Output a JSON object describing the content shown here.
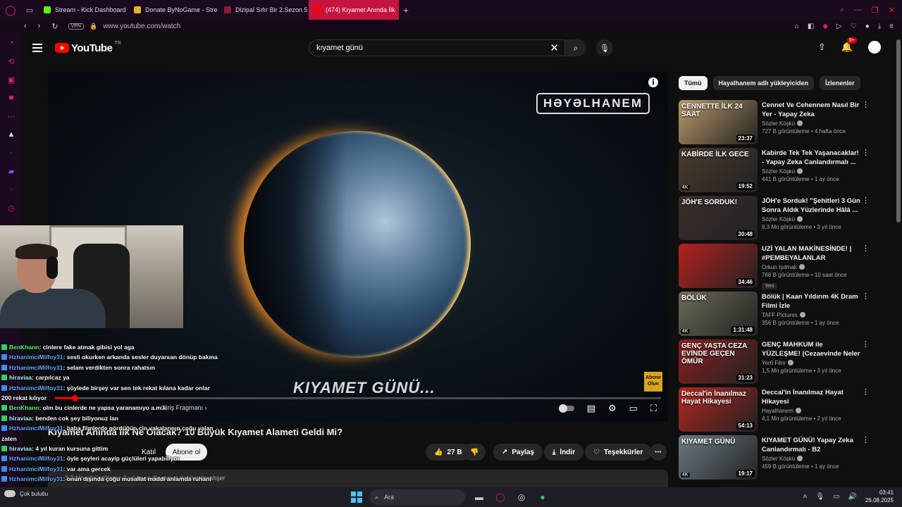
{
  "browser": {
    "tabs": [
      {
        "label": "Stream - Kick Dashboard",
        "color": "#53fc18",
        "active": false
      },
      {
        "label": "Donate ByNoGame - Stre",
        "color": "#e6b422",
        "active": false
      },
      {
        "label": "Dizipal Sıfır Bir 2.Sezon 5",
        "color": "#8a1c3c",
        "active": false
      },
      {
        "label": "(474) Kıyamet Anında İlk",
        "color": "#ff0000",
        "active": true
      }
    ],
    "url": "www.youtube.com/watch",
    "vpn": "VPN"
  },
  "youtube": {
    "logo_word": "YouTube",
    "logo_region": "TR",
    "search_value": "kıyamet günü",
    "notifications_badge": "9+"
  },
  "player": {
    "brand_logo": "HƏYƏLHANEM",
    "title_overlay": "KIYAMET GÜNÜ...",
    "subscribe_stamp_line1": "Abone",
    "subscribe_stamp_line2": "Olun",
    "chapter": "• Giriş Fragmanı",
    "progress_fraction": 0.033
  },
  "watch": {
    "title": "Kıyamet Anında İlk Ne Olacak? 10 Büyük Kıyamet Alameti Geldi Mi?",
    "join_label": "Katıl",
    "subscribe_label": "Abone ol",
    "likes": "27 B",
    "share_label": "Paylaş",
    "download_label": "İndir",
    "thanks_label": "Teşekkürler",
    "description_line": "3,7 Mn görüntüleme  2 yıl önce  #kıyamet  #ahiret  #mahşer"
  },
  "chips": [
    {
      "label": "Tümü",
      "selected": true
    },
    {
      "label": "Hayalhanem adlı yükleyiciden",
      "selected": false
    },
    {
      "label": "İzlenenler",
      "selected": false
    }
  ],
  "recommendations": [
    {
      "thumb_text": "CENNETTE İLK 24 SAAT",
      "thumb_bg": "#b99a6a",
      "duration": "23:37",
      "fourk": "",
      "title": "Cennet Ve Cehennem Nasıl Bir Yer - Yapay Zeka Canlandırmal...",
      "channel": "Sözler Köşkü",
      "meta": "727 B görüntüleme • 4 hafta önce",
      "badge": ""
    },
    {
      "thumb_text": "KABİRDE İLK GECE",
      "thumb_bg": "#4a3b2a",
      "duration": "19:52",
      "fourk": "4K",
      "title": "Kabirde Tek Tek Yaşanacaklar! - Yapay Zeka Canlandırmalı ...",
      "channel": "Sözler Köşkü",
      "meta": "441 B görüntüleme • 1 ay önce",
      "badge": ""
    },
    {
      "thumb_text": "JÖH'E SORDUK!",
      "thumb_bg": "#3a2e2a",
      "duration": "30:48",
      "fourk": "",
      "title": "JÖH'e Sorduk! \"Şehitleri 3 Gün Sonra Aldık Yüzlerinde Hâlâ ...",
      "channel": "Sözler Köşkü",
      "meta": "9,3 Mn görüntüleme • 3 yıl önce",
      "badge": ""
    },
    {
      "thumb_text": "",
      "thumb_bg": "#b3211e",
      "duration": "34:46",
      "fourk": "",
      "title": "UZİ YALAN MAKİNESİNDE! | #PEMBEYALANLAR",
      "channel": "Orkun Işıtmak",
      "meta": "768 B görüntüleme • 10 saat önce",
      "badge": "Yeni"
    },
    {
      "thumb_text": "BÖLÜK",
      "thumb_bg": "#6b6a54",
      "duration": "1:31:48",
      "fourk": "4K",
      "title": "Bölük | Kaan Yıldırım 4K Dram Filmi İzle",
      "channel": "TAFF Pictures",
      "meta": "356 B görüntüleme • 1 ay önce",
      "badge": ""
    },
    {
      "thumb_text": "GENÇ YAŞTA CEZA EVİNDE GEÇEN ÖMÜR",
      "thumb_bg": "#8a1f1f",
      "duration": "31:23",
      "fourk": "",
      "title": "GENÇ MAHKUM ile YÜZLEŞME! (Cezaevinde Neler Oluyor?)",
      "channel": "Yer6 Film",
      "meta": "1,5 Mn görüntüleme • 3 yıl önce",
      "badge": ""
    },
    {
      "thumb_text": "Deccal'in İnanılmaz Hayat Hikayesi",
      "thumb_bg": "#b3261e",
      "duration": "54:13",
      "fourk": "",
      "title": "Deccal'in İnanılmaz Hayat Hikayesi",
      "channel": "Hayalhanem",
      "meta": "4,1 Mn görüntüleme • 2 yıl önce",
      "badge": ""
    },
    {
      "thumb_text": "KIYAMET GÜNÜ",
      "thumb_bg": "#6c7a82",
      "duration": "19:17",
      "fourk": "4K",
      "title": "KIYAMET GÜNÜ! Yapay Zeka Canlandırmalı - B2",
      "channel": "Sözler Köşkü",
      "meta": "459 B görüntüleme • 1 ay önce",
      "badge": ""
    }
  ],
  "chat": [
    {
      "user": "BenKhann",
      "cls": "u1",
      "badge": "g",
      "msg": ": cinlere fake atmak gibisi yol aga"
    },
    {
      "user": "HzhanimciMilfoy31",
      "cls": "u2",
      "badge": "b",
      "msg": ": sesli okurken arkanda sesler duyarsan dönüp bakma"
    },
    {
      "user": "HzhanimciMilfoy31",
      "cls": "u2",
      "badge": "b",
      "msg": ": selam verdikten sonra rahatsın"
    },
    {
      "user": "hiraviaa",
      "cls": "u3",
      "badge": "g",
      "msg": ": carpılcaz ya"
    },
    {
      "user": "HzhanimciMilfoy31",
      "cls": "u2",
      "badge": "b",
      "msg": ": şöylede birşey var sen tek rekat kılana kadar onlar"
    },
    {
      "user": "",
      "cls": "",
      "badge": "",
      "msg": "200 rekat kılıyor"
    },
    {
      "user": "BenKhann",
      "cls": "u1",
      "badge": "g",
      "msg": ": olm bu cinlerde ne yapsa yaranamıyo a.m.k"
    },
    {
      "user": "hiraviaa",
      "cls": "u3",
      "badge": "g",
      "msg": ": benden cok şey biliyonuz lan"
    },
    {
      "user": "HzhanimciMilfoy31",
      "cls": "u2",
      "badge": "b",
      "msg": ": baba filmlerde gördüğün cin vakalarının çoğu yalan"
    },
    {
      "user": "",
      "cls": "",
      "badge": "",
      "msg": "zaten"
    },
    {
      "user": "hiraviaa",
      "cls": "u3",
      "badge": "g",
      "msg": ": 4 yıl kuran kursuna gittim"
    },
    {
      "user": "HzhanimciMilfoy31",
      "cls": "u2",
      "badge": "b",
      "msg": ": öyle şeyleri acayip güçlüleri yapabiliyor"
    },
    {
      "user": "HzhanimciMilfoy31",
      "cls": "u2",
      "badge": "b",
      "msg": ": var ama gercek"
    },
    {
      "user": "HzhanimciMilfoy31",
      "cls": "u2",
      "badge": "b",
      "msg": ": onun dışında çoğu musallat maddi anlamda ruhani"
    },
    {
      "user": "",
      "cls": "",
      "badge": "",
      "msg": "anlamda sıkıntı yaratır"
    }
  ],
  "taskbar": {
    "weather": "Çok bulutlu",
    "search_label": "Ara",
    "time": "03:41",
    "date": "26.08.2025"
  }
}
